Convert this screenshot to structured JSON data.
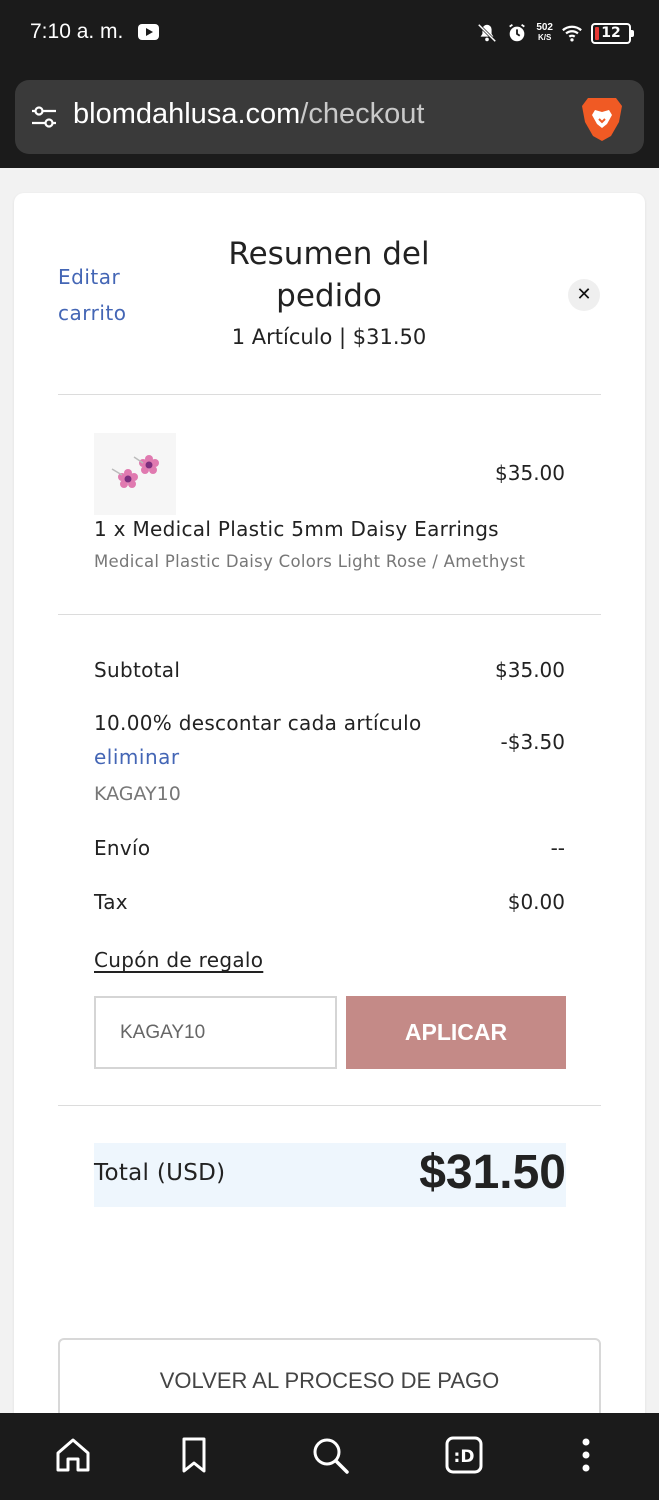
{
  "status_bar": {
    "time": "7:10 a. m.",
    "net_speed": "502",
    "net_speed_unit": "K/S",
    "battery_level": "12",
    "icons": [
      "youtube-icon",
      "mute-icon",
      "alarm-icon",
      "wifi-icon",
      "battery-icon"
    ]
  },
  "browser": {
    "url_host": "blomdahlusa.com",
    "url_path": "/checkout",
    "icons": [
      "tune-icon",
      "brave-icon"
    ]
  },
  "summary": {
    "edit_cart": "Editar carrito",
    "title": "Resumen del pedido",
    "subtitle": "1 Artículo | $31.50",
    "close_icon": "✕"
  },
  "product": {
    "price": "$35.00",
    "name": "1 x Medical Plastic 5mm Daisy Earrings",
    "variant": "Medical Plastic Daisy Colors Light Rose / Amethyst"
  },
  "totals": {
    "subtotal_label": "Subtotal",
    "subtotal_value": "$35.00",
    "discount_label": "10.00% descontar cada artículo",
    "discount_remove": "eliminar",
    "discount_code": "KAGAY10",
    "discount_value": "-$3.50",
    "shipping_label": "Envío",
    "shipping_value": "--",
    "tax_label": "Tax",
    "tax_value": "$0.00"
  },
  "coupon": {
    "link": "Cupón de regalo",
    "input_value": "KAGAY10",
    "apply_label": "APLICAR"
  },
  "total": {
    "label": "Total (USD)",
    "value": "$31.50"
  },
  "back_button": "VOLVER AL PROCESO DE PAGO",
  "bottom_nav": [
    "home-icon",
    "bookmark-icon",
    "search-icon",
    "tabs-icon",
    "more-icon"
  ],
  "colors": {
    "link": "#4466b5",
    "apply_button": "#c48a87",
    "total_background": "#eef6fd",
    "chrome_dark": "#1b1b1b"
  }
}
